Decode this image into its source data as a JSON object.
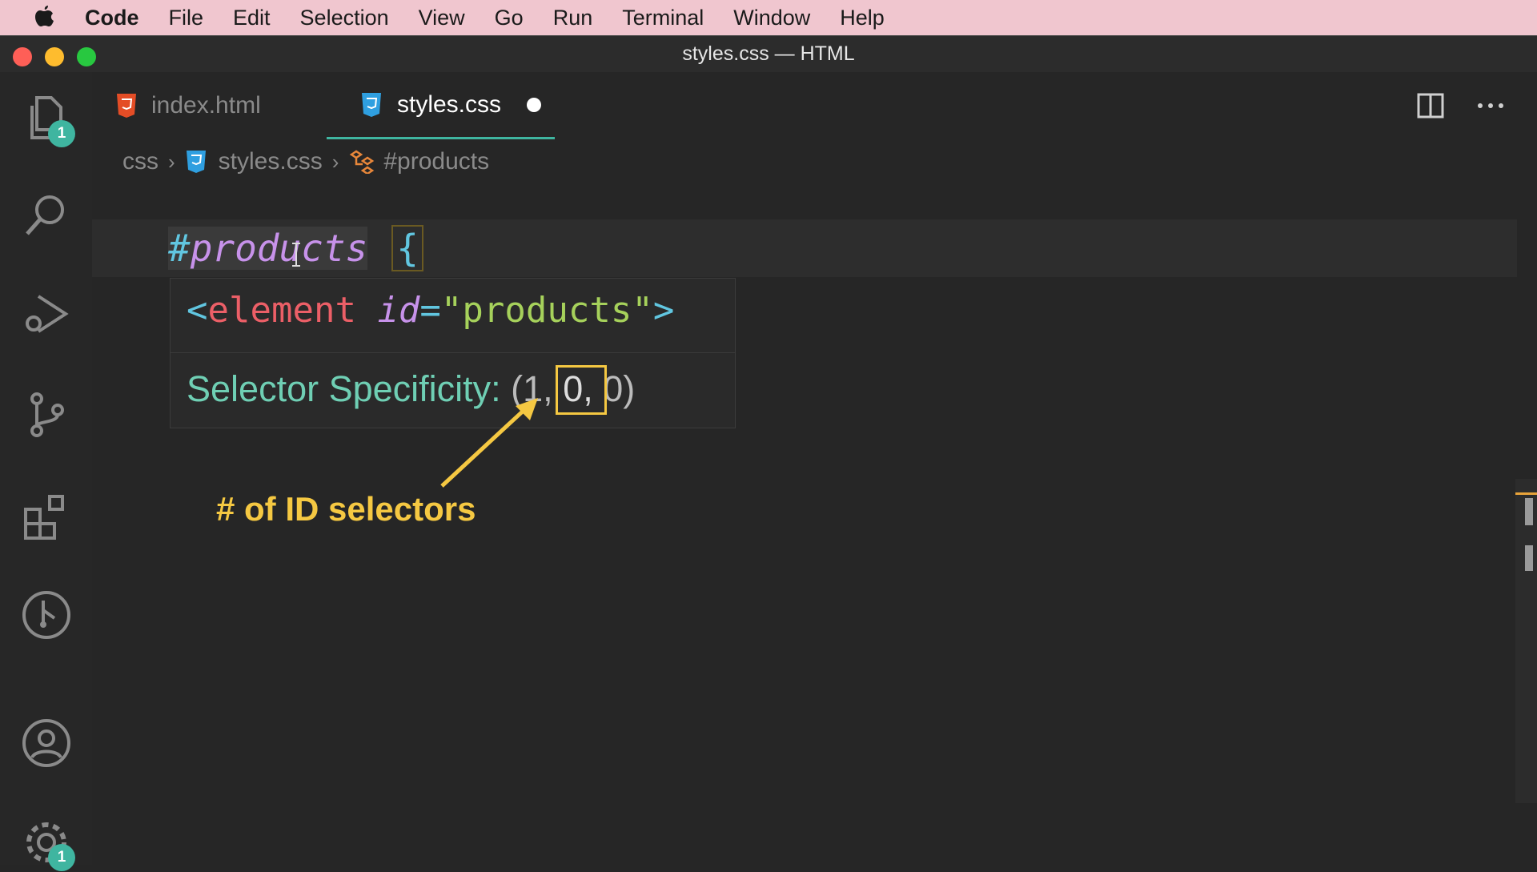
{
  "menubar": {
    "app": "Code",
    "items": [
      "File",
      "Edit",
      "Selection",
      "View",
      "Go",
      "Run",
      "Terminal",
      "Window",
      "Help"
    ]
  },
  "window": {
    "title": "styles.css — HTML"
  },
  "activity_bar": {
    "explorer_badge": "1",
    "settings_badge": "1",
    "icons": [
      "files-icon",
      "search-icon",
      "run-debug-icon",
      "source-control-icon",
      "extensions-icon",
      "git-graph-icon",
      "account-icon",
      "gear-icon"
    ]
  },
  "tabs": [
    {
      "label": "index.html",
      "icon": "html5-icon",
      "active": false
    },
    {
      "label": "styles.css",
      "icon": "css3-icon",
      "active": true,
      "dirty": true
    }
  ],
  "breadcrumb": {
    "folder": "css",
    "file": "styles.css",
    "symbol": "#products"
  },
  "editor": {
    "selector": "#products",
    "brace": "{"
  },
  "hover": {
    "open": "<",
    "tag": "element",
    "attr": "id",
    "eq": "=",
    "value": "\"products\"",
    "close": ">",
    "spec_label": "Selector Specificity: ",
    "spec_value_start": "(1, ",
    "spec_value_mid": "0,",
    "spec_value_end": " 0)"
  },
  "annotation": {
    "text": "# of ID selectors"
  },
  "colors": {
    "accent": "#3fb5a0",
    "annotation": "#f5c842",
    "css_keyword": "#61c6e0",
    "selector": "#c792ea",
    "tag": "#ec5f67",
    "string": "#a6d15b",
    "hover_label": "#6fcfb4"
  }
}
